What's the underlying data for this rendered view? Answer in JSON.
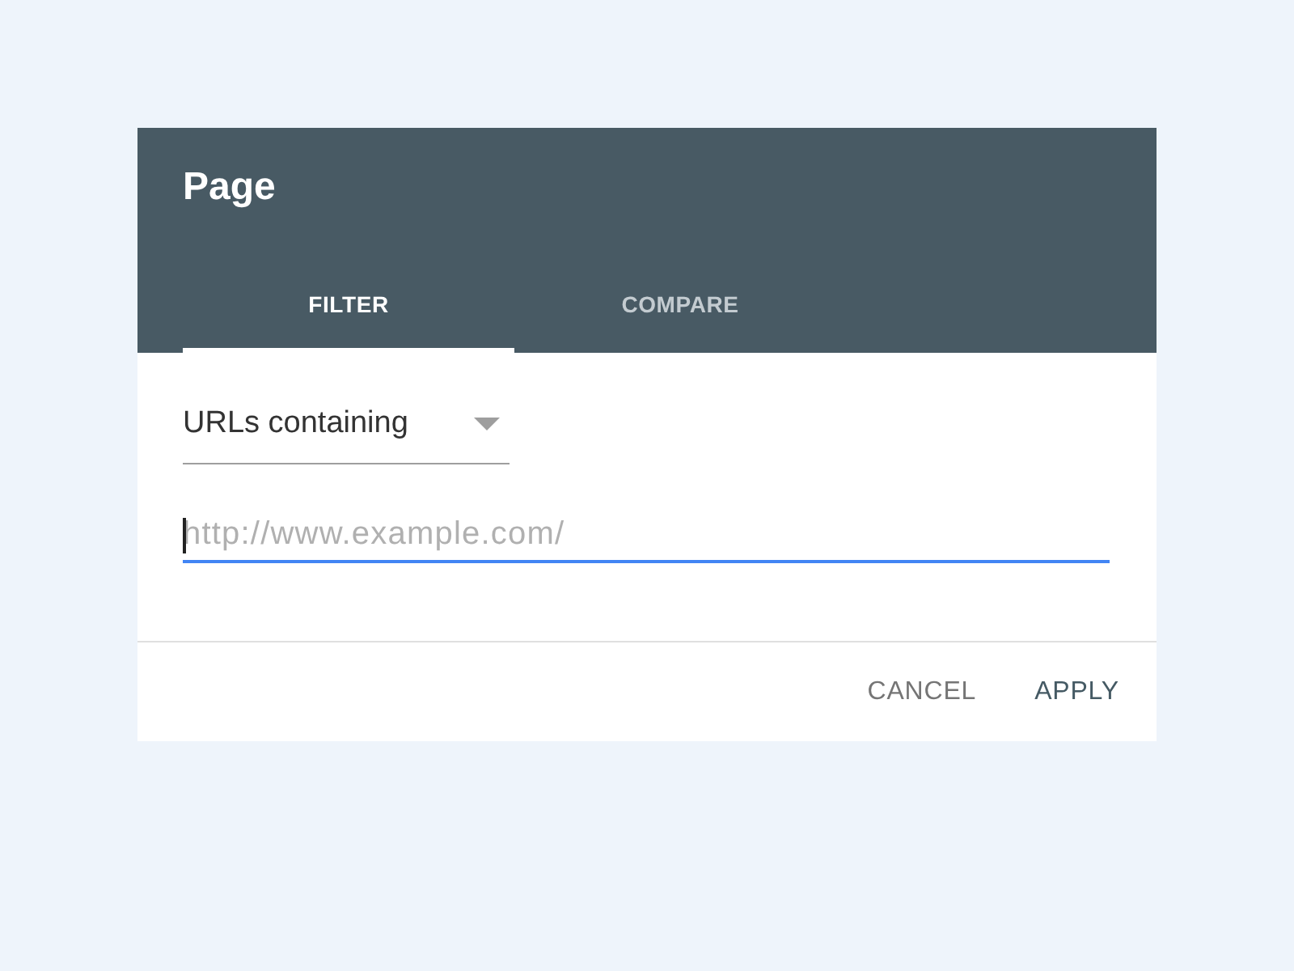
{
  "dialog": {
    "title": "Page",
    "tabs": [
      {
        "label": "FILTER",
        "selected": true
      },
      {
        "label": "COMPARE",
        "selected": false
      }
    ],
    "dropdown": {
      "value": "URLs containing"
    },
    "url_field": {
      "placeholder": "http://www.example.com/",
      "focused": true
    },
    "buttons": [
      {
        "label": "CANCEL",
        "kind": "secondary"
      },
      {
        "label": "APPLY",
        "kind": "primary"
      }
    ]
  }
}
